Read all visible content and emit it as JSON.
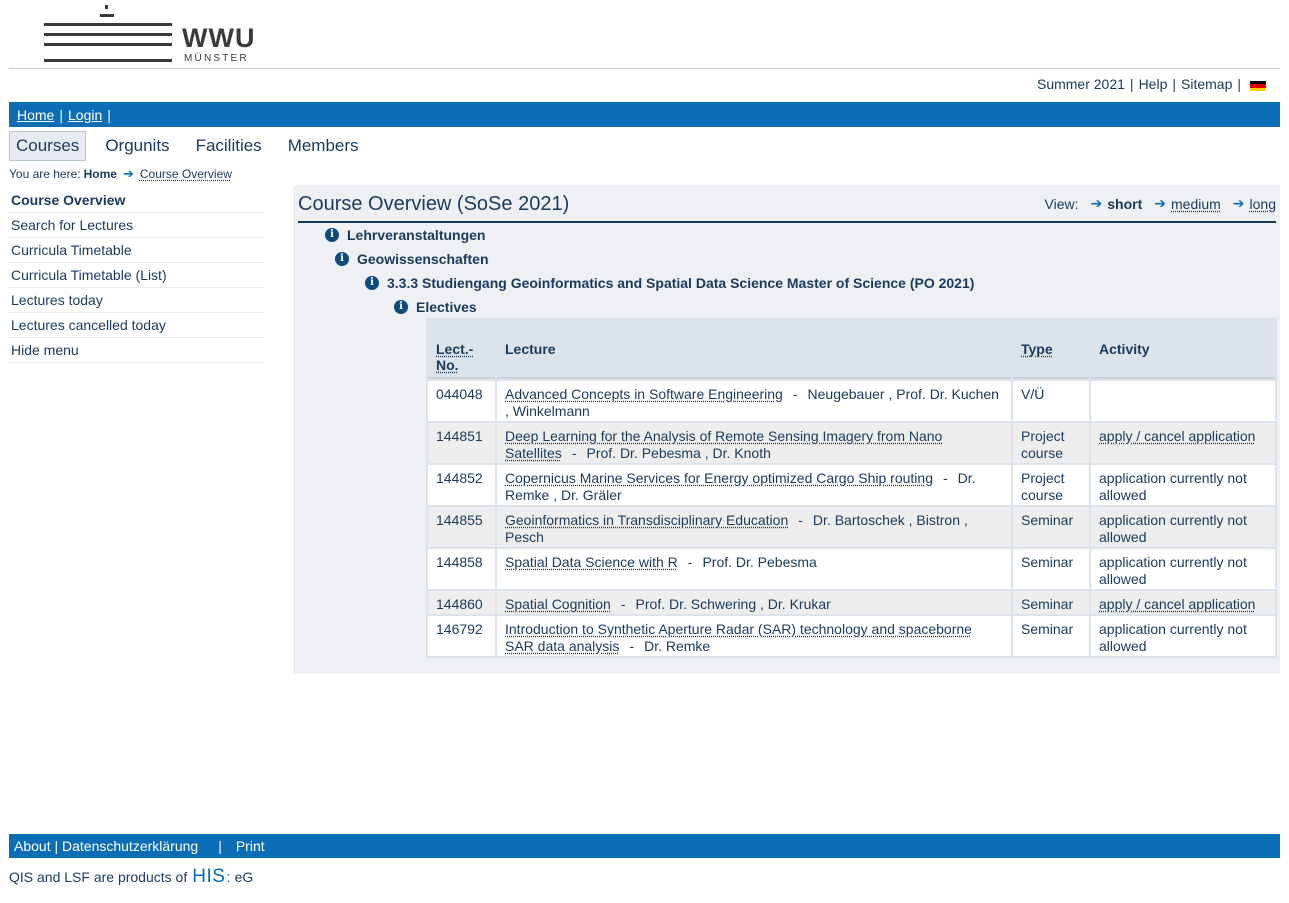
{
  "logo": {
    "wordmark": "WWU",
    "sub": "MÜNSTER"
  },
  "toplinks": {
    "semester": "Summer 2021",
    "help": "Help",
    "sitemap": "Sitemap"
  },
  "flag_colors": [
    "#000000",
    "#dd0000",
    "#ffce00"
  ],
  "bluebar": {
    "home": "Home",
    "login": "Login"
  },
  "tabs": [
    "Courses",
    "Orgunits",
    "Facilities",
    "Members"
  ],
  "breadcrumb": {
    "prefix": "You are here:",
    "home": "Home",
    "current": "Course Overview"
  },
  "sidebar": [
    "Course Overview",
    "Search for Lectures",
    "Curricula Timetable",
    "Curricula Timetable (List)",
    "Lectures today",
    "Lectures cancelled today",
    "Hide menu"
  ],
  "main": {
    "title": "Course Overview (SoSe 2021)",
    "view_label": "View:",
    "view_short": "short",
    "view_medium": "medium",
    "view_long": "long"
  },
  "tree": [
    "Lehrveranstaltungen",
    "Geowissenschaften",
    "3.3.3 Studiengang Geoinformatics and Spatial Data Science Master of Science (PO 2021)",
    "Electives"
  ],
  "table": {
    "headers": {
      "no": "Lect.-No.",
      "lecture": "Lecture",
      "type": "Type",
      "activity": "Activity"
    },
    "rows": [
      {
        "no": "044048",
        "title": "Advanced Concepts in Software Engineering",
        "lecturers": "Neugebauer ,  Prof. Dr. Kuchen ,  Winkelmann",
        "type": "V/Ü",
        "activity": "",
        "activity_link": false
      },
      {
        "no": "144851",
        "title": "Deep Learning for the Analysis of Remote Sensing Imagery from Nano Satellites",
        "lecturers": "Prof. Dr. Pebesma ,  Dr. Knoth",
        "type": "Project course",
        "activity": "apply / cancel application",
        "activity_link": true
      },
      {
        "no": "144852",
        "title": "Copernicus Marine Services for Energy optimized Cargo Ship routing",
        "lecturers": "Dr. Remke ,  Dr. Gräler",
        "type": "Project course",
        "activity": "application currently not allowed",
        "activity_link": false
      },
      {
        "no": "144855",
        "title": "Geoinformatics in Transdisciplinary Education",
        "lecturers": "Dr. Bartoschek ,  Bistron ,  Pesch",
        "type": "Seminar",
        "activity": "application currently not allowed",
        "activity_link": false
      },
      {
        "no": "144858",
        "title": "Spatial Data Science with R",
        "lecturers": "Prof. Dr. Pebesma",
        "type": "Seminar",
        "activity": "application currently not allowed",
        "activity_link": false
      },
      {
        "no": "144860",
        "title": "Spatial Cognition",
        "lecturers": "Prof. Dr. Schwering ,  Dr. Krukar",
        "type": "Seminar",
        "activity": "apply / cancel application",
        "activity_link": true
      },
      {
        "no": "146792",
        "title": "Introduction to Synthetic Aperture Radar (SAR) technology and spaceborne SAR data analysis",
        "lecturers": "Dr. Remke",
        "type": "Seminar",
        "activity": "application currently not allowed",
        "activity_link": false
      }
    ]
  },
  "footer": {
    "about": "About | Datenschutzerklärung",
    "print": "Print",
    "products": "QIS and LSF are products of",
    "his": "HIS",
    "eg": "eG"
  }
}
